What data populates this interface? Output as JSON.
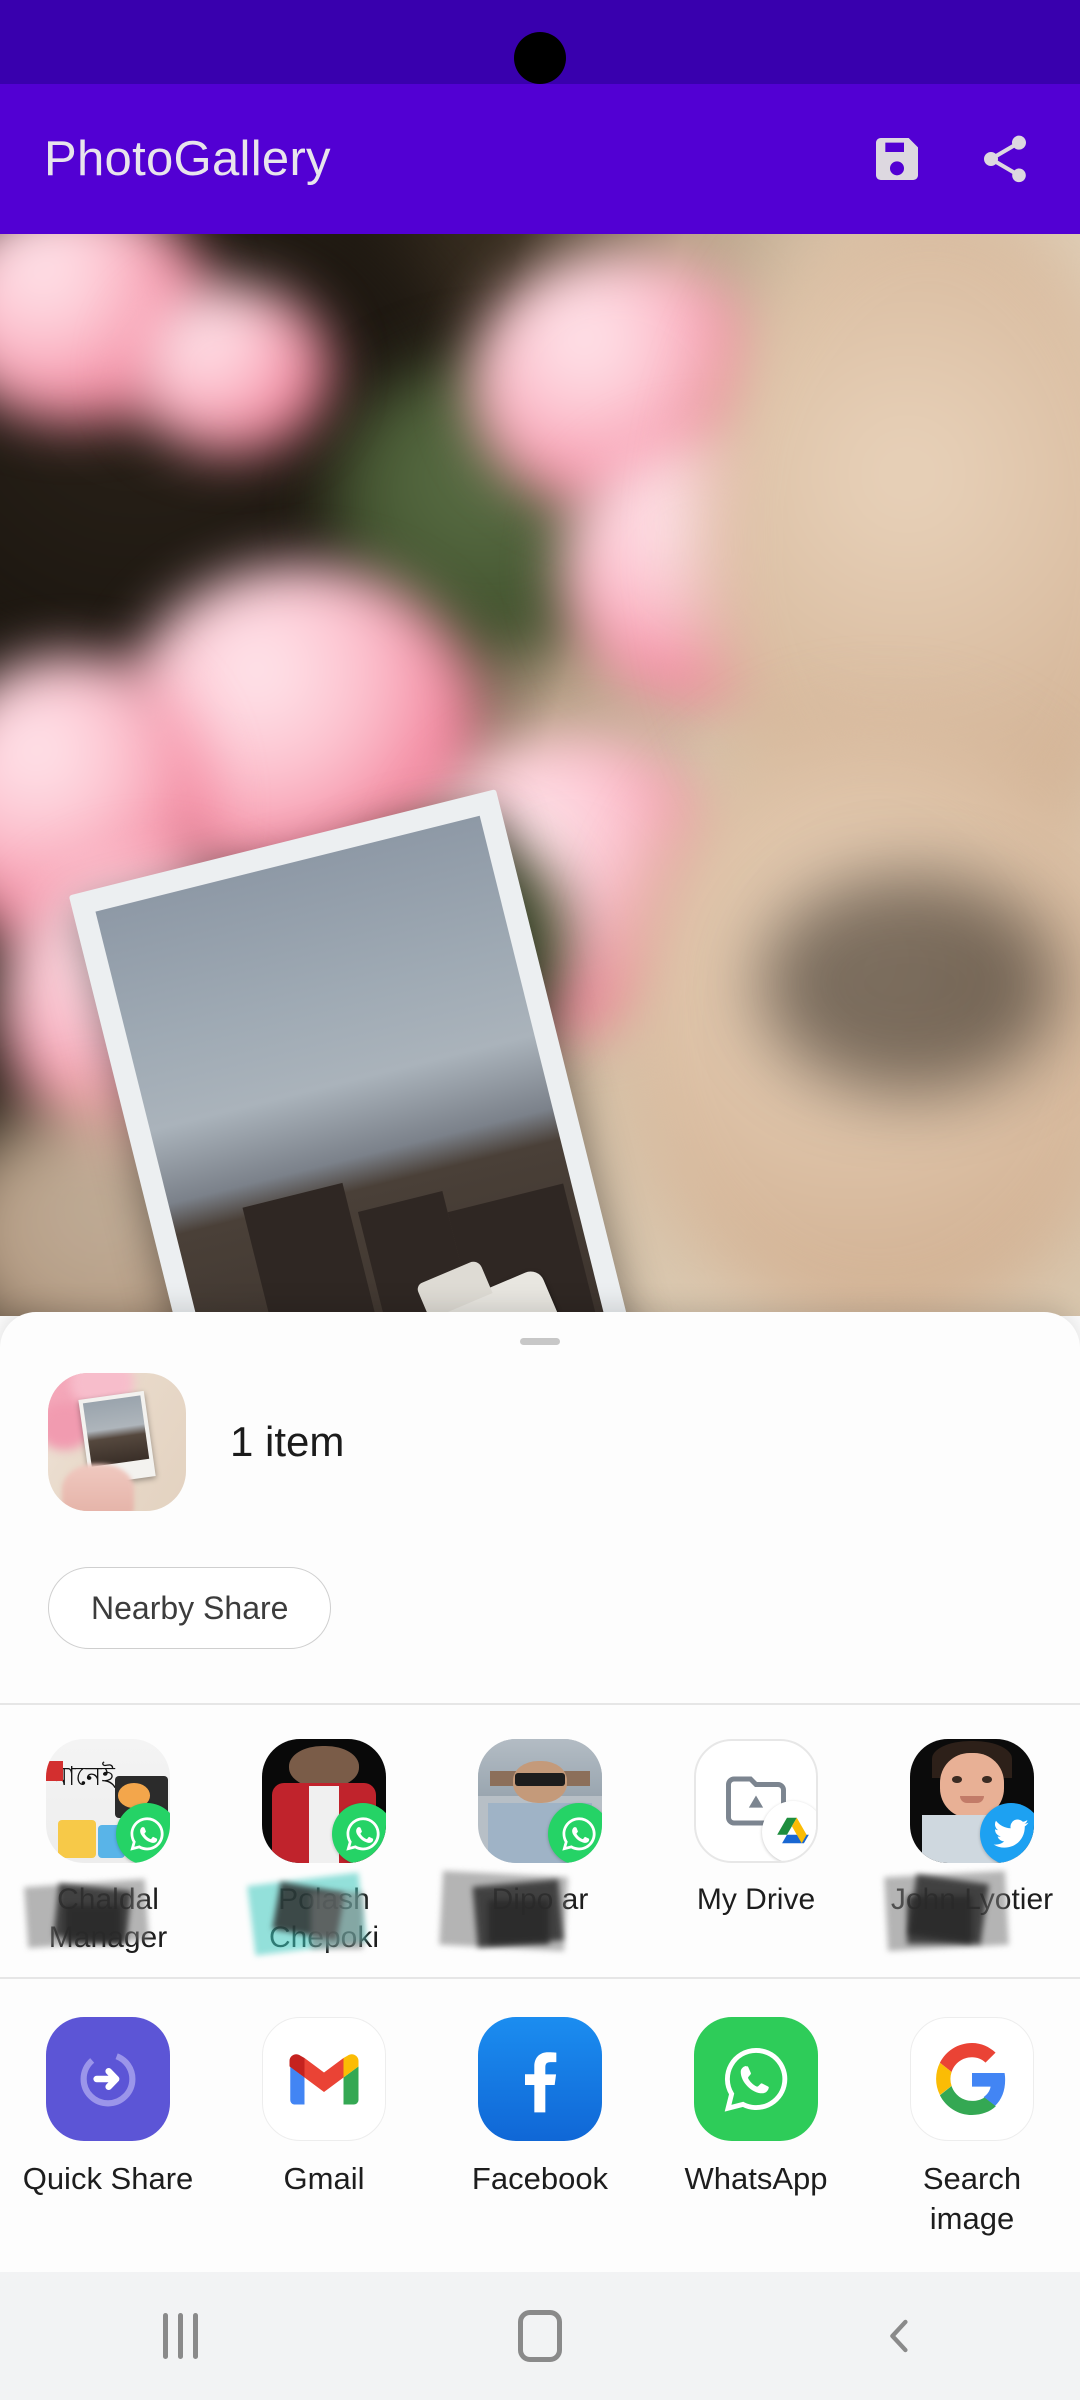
{
  "status_bar": {
    "punch_hole": "front-camera",
    "bg": "#3900AE"
  },
  "app_bar": {
    "title": "PhotoGallery",
    "bg": "#5200D3",
    "actions": [
      {
        "name": "save-icon",
        "label": "Save"
      },
      {
        "name": "share-icon",
        "label": "Share"
      }
    ]
  },
  "photo": {
    "description": "Hand holding a polaroid photo of a white car in front of buildings, pink carnation flowers in the background"
  },
  "share_sheet": {
    "drag_handle": "drag-handle",
    "item_count": "1 item",
    "nearby_share_label": "Nearby Share",
    "contacts": [
      {
        "name": "Chaldal Manager",
        "badge": "whatsapp",
        "avatar": "chaldal-logo"
      },
      {
        "name": "Polash Chepoki",
        "badge": "whatsapp",
        "avatar": "person-red-jacket"
      },
      {
        "name": "Dipo    ar",
        "badge": "whatsapp",
        "avatar": "person-sunglasses"
      },
      {
        "name": "My Drive",
        "badge": "google-drive",
        "avatar": "folder-icon"
      },
      {
        "name": "John Lyotier",
        "badge": "twitter",
        "avatar": "person-smiling"
      }
    ],
    "apps": [
      {
        "name": "Quick Share",
        "icon": "quick-share-icon"
      },
      {
        "name": "Gmail",
        "icon": "gmail-icon"
      },
      {
        "name": "Facebook",
        "icon": "facebook-icon"
      },
      {
        "name": "WhatsApp",
        "icon": "whatsapp-icon"
      },
      {
        "name": "Search image",
        "icon": "google-icon"
      }
    ]
  },
  "nav_bar": {
    "recents": "recents-button",
    "home": "home-button",
    "back": "back-button"
  }
}
